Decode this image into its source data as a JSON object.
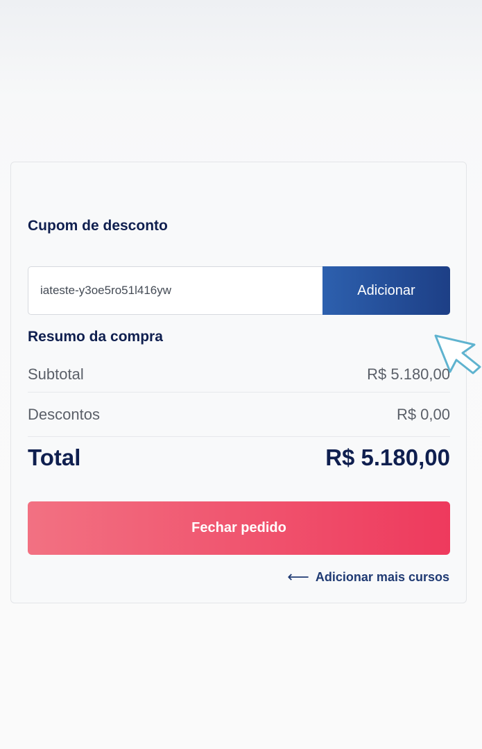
{
  "coupon": {
    "title": "Cupom de desconto",
    "input_value": "iateste-y3oe5ro51l416yw",
    "button_label": "Adicionar"
  },
  "summary": {
    "title": "Resumo da compra",
    "subtotal_label": "Subtotal",
    "subtotal_value": "R$ 5.180,00",
    "discounts_label": "Descontos",
    "discounts_value": "R$ 0,00",
    "total_label": "Total",
    "total_value": "R$ 5.180,00"
  },
  "actions": {
    "checkout_label": "Fechar pedido",
    "more_courses_label": "Adicionar mais cursos",
    "more_courses_icon": "arrow-left-icon"
  },
  "pointer": {
    "icon": "mouse-pointer-icon"
  },
  "colors": {
    "primary_navy": "#0f1f4f",
    "button_blue": "#2d60ae",
    "checkout_red": "#ee3a5d",
    "pointer_teal": "#5fb3cf"
  }
}
